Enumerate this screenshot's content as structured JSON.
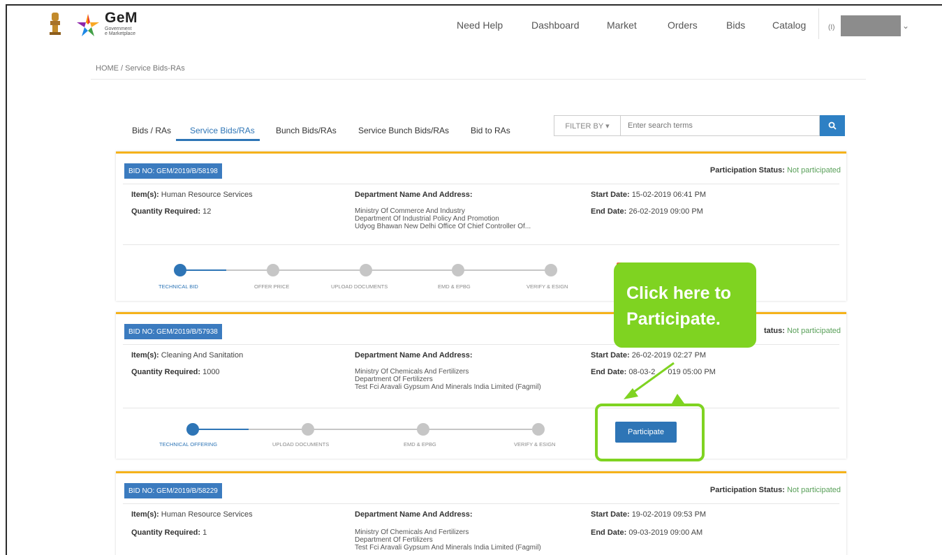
{
  "header": {
    "logo_title": "GeM",
    "logo_sub1": "Government",
    "logo_sub2": "e Marketplace",
    "nav": [
      "Need Help",
      "Dashboard",
      "Market",
      "Orders",
      "Bids",
      "Catalog"
    ],
    "user_icon": "user-id-icon"
  },
  "breadcrumb": "HOME / Service Bids-RAs",
  "tabs": [
    "Bids / RAs",
    "Service Bids/RAs",
    "Bunch Bids/RAs",
    "Service Bunch Bids/RAs",
    "Bid to RAs"
  ],
  "active_tab": "Service Bids/RAs",
  "filter": {
    "label": "FILTER BY ▾",
    "placeholder": "Enter search terms"
  },
  "colors": {
    "accent": "#2e75b6",
    "card_border": "#f5b21b",
    "callout": "#7fd321",
    "status_text": "#5aa05a"
  },
  "labels": {
    "items": "Item(s):",
    "quantity": "Quantity Required:",
    "department": "Department Name And Address:",
    "start": "Start Date:",
    "end": "End Date:",
    "participation": "Participation Status:",
    "participate_button": "Participate"
  },
  "bids": [
    {
      "bid_no": "BID NO: GEM/2019/B/58198",
      "status": "Not participated",
      "items": "Human Resource Services",
      "quantity": "12",
      "dept": [
        "Ministry Of Commerce And Industry",
        "Department Of Industrial Policy And Promotion",
        "Udyog Bhawan New Delhi Office Of Chief Controller Of..."
      ],
      "start": "15-02-2019 06:41 PM",
      "end": "26-02-2019 09:00 PM",
      "steps": [
        "TECHNICAL BID",
        "OFFER PRICE",
        "UPLOAD DOCUMENTS",
        "EMD & EPBG",
        "VERIFY & ESIGN"
      ]
    },
    {
      "bid_no": "BID NO: GEM/2019/B/57938",
      "status": "Not participated",
      "status_visible": "tatus:",
      "items": "Cleaning And Sanitation",
      "quantity": "1000",
      "dept": [
        "Ministry Of Chemicals And Fertilizers",
        "Department Of Fertilizers",
        "Test Fci Aravali Gypsum And Minerals India Limited (Fagmil)"
      ],
      "start": "26-02-2019 02:27 PM",
      "end_a": "08-03-2",
      "end_b": "019 05:00 PM",
      "steps": [
        "TECHNICAL OFFERING",
        "UPLOAD DOCUMENTS",
        "EMD & EPBG",
        "VERIFY & ESIGN"
      ]
    },
    {
      "bid_no": "BID NO: GEM/2019/B/58229",
      "status": "Not participated",
      "items": "Human Resource Services",
      "quantity": "1",
      "dept": [
        "Ministry Of Chemicals And Fertilizers",
        "Department Of Fertilizers",
        "Test Fci Aravali Gypsum And Minerals India Limited (Fagmil)"
      ],
      "start": "19-02-2019 09:53 PM",
      "end": "09-03-2019 09:00 AM"
    }
  ],
  "callout": {
    "line1": "Click here to",
    "line2": "Participate."
  }
}
